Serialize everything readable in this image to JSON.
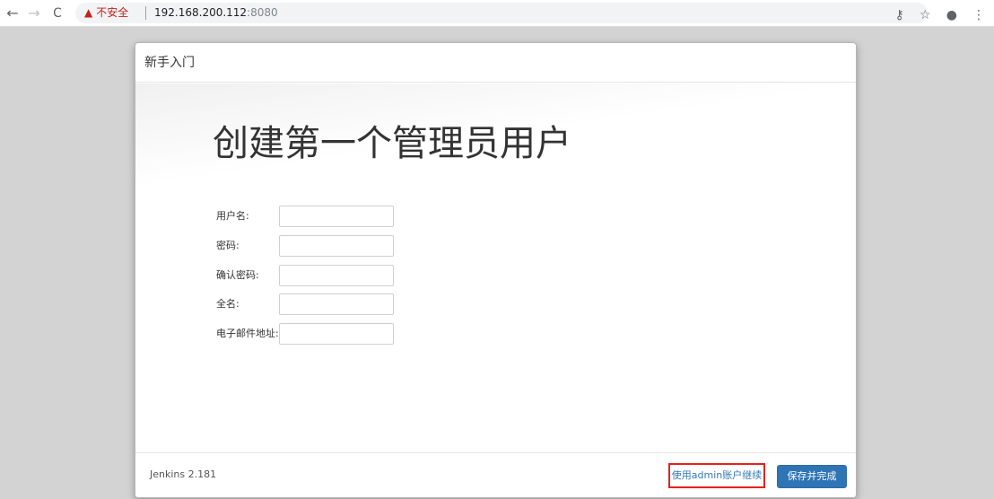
{
  "browser": {
    "security_label": "不安全",
    "url_host": "192.168.200.112",
    "url_port": ":8080"
  },
  "dialog": {
    "header_title": "新手入门",
    "main_title": "创建第一个管理员用户",
    "fields": {
      "username_label": "用户名:",
      "password_label": "密码:",
      "confirm_password_label": "确认密码:",
      "fullname_label": "全名:",
      "email_label": "电子邮件地址:"
    },
    "footer": {
      "version": "Jenkins 2.181",
      "admin_continue_label": "使用admin账户继续",
      "save_finish_label": "保存并完成"
    }
  },
  "colors": {
    "accent": "#2f74b5",
    "link": "#337ab7",
    "highlight_border": "#e8201f"
  }
}
